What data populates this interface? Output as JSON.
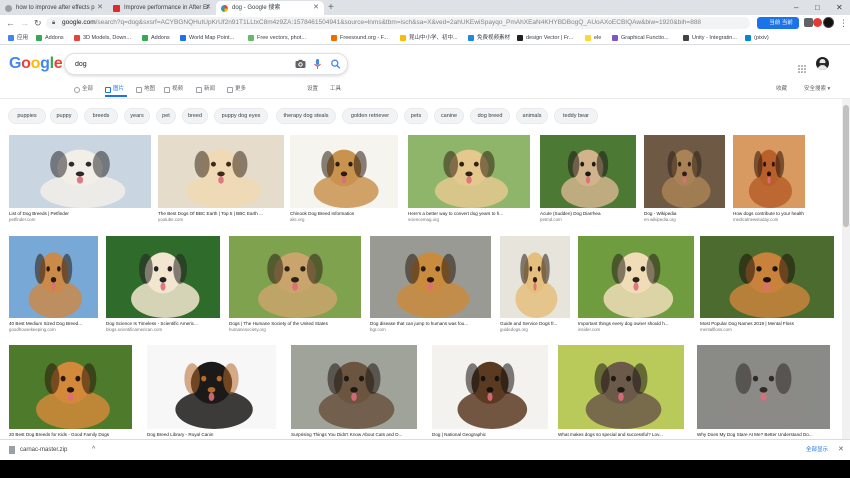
{
  "colors": {
    "google_blue": "#4285f4",
    "google_red": "#ea4335",
    "google_yellow": "#fbbc05",
    "google_green": "#34a853",
    "link_blue": "#1a73e8",
    "chip_bg": "#f1f3f4"
  },
  "browser": {
    "tabs": [
      {
        "title": "how to improve after effects p",
        "icon": "generic-page-icon",
        "active": false
      },
      {
        "title": "Improve performance in After Ef",
        "icon": "adobe-icon",
        "active": false
      },
      {
        "title": "dog - Google 搜索",
        "icon": "google-icon",
        "active": true
      }
    ],
    "new_tab": "+",
    "window_controls": {
      "minimize": "–",
      "maximize": "□",
      "close": "✕"
    },
    "nav": {
      "back": "←",
      "forward": "→",
      "reload": "↻"
    },
    "url_host": "google.com",
    "url_rest": "/search?q=dog&sxsrf=ACYBGNQHutUpKrUf2n91T1LLtxC8m4z9ZA:1578461504941&source=lnms&tbm=isch&sa=X&ved=2ahUKEwiSpayqo_PmAhXEaN4KHYBDBogQ_AUoAXoECBIQAw&biw=1920&bih=888",
    "extension_badge": "当前 当前",
    "bookmarks": [
      {
        "label": "应用",
        "icon": "apps-grid-icon"
      },
      {
        "label": "Addons",
        "icon": "puzzle-icon"
      },
      {
        "label": "3D Models, Down...",
        "icon": "star-icon"
      },
      {
        "label": "Addons",
        "icon": "puzzle-icon"
      },
      {
        "label": "World Map Point...",
        "icon": "map-icon"
      },
      {
        "label": "Free vectors, phot...",
        "icon": "leaf-icon"
      },
      {
        "label": "Freesound.org - F...",
        "icon": "sound-icon"
      },
      {
        "label": "昆山中小学、初中...",
        "icon": "school-icon"
      },
      {
        "label": "免费视频素材",
        "icon": "video-icon"
      },
      {
        "label": "design Vector | Fr...",
        "icon": "vector-icon"
      },
      {
        "label": "ele",
        "icon": "bolt-icon"
      },
      {
        "label": "Graphical Functio...",
        "icon": "graph-icon"
      },
      {
        "label": "Unity - Integratin...",
        "icon": "unity-icon"
      },
      {
        "label": "(pixiv)",
        "icon": "pixiv-icon"
      }
    ]
  },
  "google": {
    "logo": [
      "G",
      "o",
      "o",
      "g",
      "l",
      "e"
    ],
    "query": "dog",
    "search_tabs": [
      {
        "label": "全部",
        "icon": "search-small-icon"
      },
      {
        "label": "图片",
        "icon": "image-icon"
      },
      {
        "label": "地图",
        "icon": "map-pin-icon"
      },
      {
        "label": "视频",
        "icon": "video-small-icon"
      },
      {
        "label": "新闻",
        "icon": "news-icon"
      },
      {
        "label": "更多",
        "icon": "more-icon"
      }
    ],
    "settings": "设置",
    "tools": "工具",
    "saved": "收藏",
    "safe_search": "安全搜索 ▾",
    "chips": [
      "puppies",
      "puppy",
      "breeds",
      "years",
      "pet",
      "breed",
      "puppy dog eyes",
      "therapy dog steals",
      "golden retriever",
      "pets",
      "canine",
      "dog breed",
      "animals",
      "teddy bear"
    ],
    "results": [
      {
        "caption": "List of Dog Breeds | Petfinder",
        "source": "petfinder.com",
        "bg": "#c9d6e2",
        "fur": "#f2efe9",
        "dark": "#2b2b2b"
      },
      {
        "caption": "The Best Dogs Of BBC Earth | Top 5 | BBC Earth ...",
        "source": "youtube.com",
        "bg": "#e6dccb",
        "fur": "#f0d9b5",
        "dark": "#3b2a1a"
      },
      {
        "caption": "Chinook Dog Breed Information",
        "source": "akc.org",
        "bg": "#f6f4ef",
        "fur": "#c9934f",
        "dark": "#2a1d10"
      },
      {
        "caption": "Here's a better way to convert dog years to h...",
        "source": "sciencemag.org",
        "bg": "#8fb56b",
        "fur": "#e4c88e",
        "dark": "#332211"
      },
      {
        "caption": "Acute (Sudden) Dog Diarrhea",
        "source": "petmd.com",
        "bg": "#4c7a35",
        "fur": "#d2b48c",
        "dark": "#1e1a16"
      },
      {
        "caption": "Dog - Wikipedia",
        "source": "en.wikipedia.org",
        "bg": "#6e5a44",
        "fur": "#a98356",
        "dark": "#2c2118"
      },
      {
        "caption": "How dogs contribute to your health e...",
        "source": "medicalnewstoday.com",
        "bg": "#d89a60",
        "fur": "#b85f2a",
        "dark": "#2a140a"
      },
      {
        "caption": "40 Best Medium Sized Dog Breed...",
        "source": "goodhousekeeping.com",
        "bg": "#78a8d6",
        "fur": "#c98a4a",
        "dark": "#2a1a0c"
      },
      {
        "caption": "Dog Science Is Timeless - Scientific Americ...",
        "source": "blogs.scientificamerican.com",
        "bg": "#2f6b2a",
        "fur": "#f2e6d0",
        "dark": "#222"
      },
      {
        "caption": "Dogs | The Humane Society of the United States",
        "source": "humanesociety.org",
        "bg": "#7fa24e",
        "fur": "#c9a46c",
        "dark": "#2e2214"
      },
      {
        "caption": "Dog disease that can jump to humans was fou...",
        "source": "bgr.com",
        "bg": "#9a9a94",
        "fur": "#c98b3e",
        "dark": "#2a1b0c"
      },
      {
        "caption": "Guide and Service Dogs fr...",
        "source": "guidedogs.org",
        "bg": "#e7e4dc",
        "fur": "#e4bf7e",
        "dark": "#2b1d10"
      },
      {
        "caption": "Important things every dog owner should h...",
        "source": "insider.com",
        "bg": "#6f9c3f",
        "fur": "#f0ddb8",
        "dark": "#2a2118"
      },
      {
        "caption": "Most Popular Dog Names 2019 | Mental Floss",
        "source": "mentalfloss.com",
        "bg": "#4c6b2e",
        "fur": "#c9823c",
        "dark": "#1b1208"
      },
      {
        "caption": "20 Best Dog Breeds for Kids - Good Family Dogs",
        "source": "",
        "bg": "#4e7a2c",
        "fur": "#d28a3a",
        "dark": "#2a170a"
      },
      {
        "caption": "Dog Breed Library - Royal Canin",
        "source": "",
        "bg": "#f7f7f7",
        "fur": "#1c1a18",
        "dark": "#b76a2a"
      },
      {
        "caption": "Surprising Things You Didn't Know About Cats and D...",
        "source": "",
        "bg": "#a0a39a",
        "fur": "#6b5440",
        "dark": "#1e1812"
      },
      {
        "caption": "Dog | National Geographic",
        "source": "",
        "bg": "#f4f2ee",
        "fur": "#5a3b22",
        "dark": "#161210"
      },
      {
        "caption": "What makes dogs so special and successful? Lov...",
        "source": "",
        "bg": "#b9c95a",
        "fur": "#6b5a4a",
        "dark": "#201a14"
      },
      {
        "caption": "Why Does My Dog Stare At Me? Better Understand Do...",
        "source": "",
        "bg": "#8a8a86",
        "fur": "#8c8a86",
        "dark": "#2e2a26"
      }
    ]
  },
  "download": {
    "filename": "carnac-master.zip",
    "caret": "^",
    "show_all": "全部显示",
    "close": "✕"
  }
}
